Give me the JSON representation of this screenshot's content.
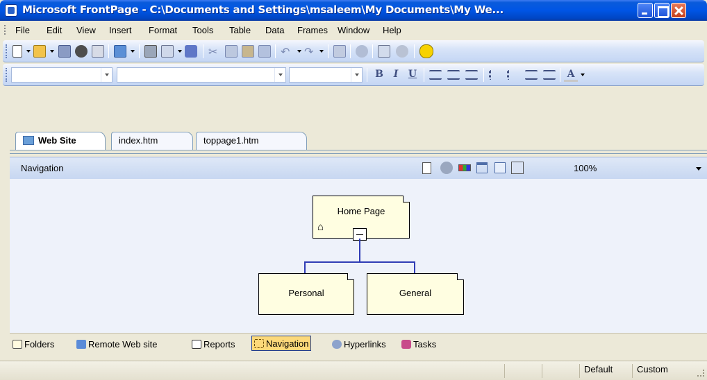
{
  "window": {
    "title": "Microsoft FrontPage - C:\\Documents and Settings\\msaleem\\My Documents\\My We..."
  },
  "menubar": {
    "items": [
      "File",
      "Edit",
      "View",
      "Insert",
      "Format",
      "Tools",
      "Table",
      "Data",
      "Frames",
      "Window",
      "Help"
    ]
  },
  "toolbar_standard": {
    "icons": [
      "new-page-icon",
      "open-folder-icon",
      "save-icon",
      "search-icon",
      "publish-icon",
      "toggle-pane-icon",
      "print-icon",
      "print-preview-icon",
      "spelling-icon",
      "cut-icon",
      "copy-icon",
      "paste-icon",
      "format-painter-icon",
      "undo-icon",
      "redo-icon",
      "insert-table-icon",
      "web-component-icon",
      "refresh-icon",
      "stop-icon",
      "help-icon"
    ]
  },
  "toolbar_formatting": {
    "style_value": "",
    "font_value": "",
    "size_value": "",
    "bold_label": "B",
    "italic_label": "I",
    "underline_label": "U",
    "font_color_label": "A"
  },
  "tabs": [
    {
      "label": "Web Site",
      "active": true
    },
    {
      "label": "index.htm",
      "active": false
    },
    {
      "label": "toppage1.htm",
      "active": false
    }
  ],
  "nav_header": {
    "label": "Navigation",
    "zoom": "100%"
  },
  "navigation_tree": {
    "root": "Home Page",
    "children": [
      "Personal",
      "General"
    ]
  },
  "viewbar": {
    "items": [
      {
        "label": "Folders",
        "icon": "folder-icon",
        "selected": false
      },
      {
        "label": "Remote Web site",
        "icon": "remote-site-icon",
        "selected": false
      },
      {
        "label": "Reports",
        "icon": "reports-icon",
        "selected": false
      },
      {
        "label": "Navigation",
        "icon": "navigation-icon",
        "selected": true
      },
      {
        "label": "Hyperlinks",
        "icon": "hyperlinks-icon",
        "selected": false
      },
      {
        "label": "Tasks",
        "icon": "tasks-icon",
        "selected": false
      }
    ]
  },
  "statusbar": {
    "mode1": "Default",
    "mode2": "Custom"
  },
  "colors": {
    "title_bar": "#0055e5",
    "toolbar": "#c4d6f4",
    "page_box": "#fffee1",
    "tree_line": "#2f3cb5",
    "selected_view": "#fcd97a"
  }
}
